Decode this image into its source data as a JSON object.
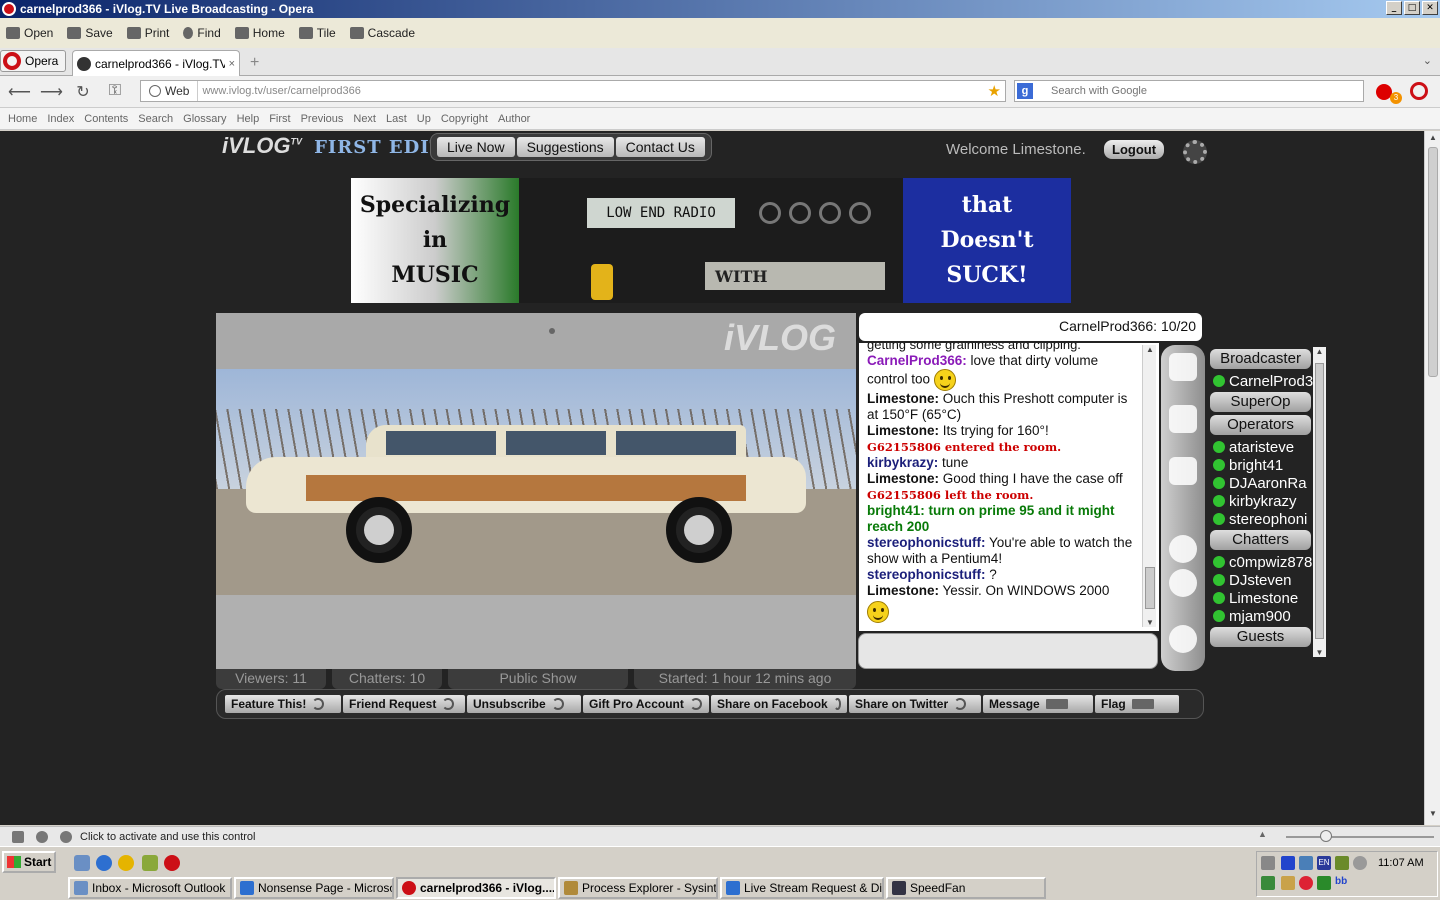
{
  "window": {
    "title": "carnelprod366 - iVlog.TV Live Broadcasting - Opera",
    "min": "_",
    "max": "□",
    "close": "✕"
  },
  "toolbar": {
    "items": [
      "Open",
      "Save",
      "Print",
      "Find",
      "Home",
      "Tile",
      "Cascade"
    ]
  },
  "tabs": {
    "opera_label": "Opera",
    "active_tab": "carnelprod366 - iVlog.TV ...",
    "close": "×",
    "new": "+",
    "menu": "⌄"
  },
  "address": {
    "site_label": "Web",
    "url_host": "www.ivlog.tv",
    "url_path": "/user/carnelprod366",
    "search_engine": "g",
    "search_placeholder": "Search with Google",
    "badge": "3"
  },
  "linkbar": {
    "items": [
      "Home",
      "Index",
      "Contents",
      "Search",
      "Glossary",
      "Help",
      "First",
      "Previous",
      "Next",
      "Last",
      "Up",
      "Copyright",
      "Author"
    ]
  },
  "site": {
    "logo": "iVLOG",
    "logo_tv": "TV",
    "edition": "FIRST EDITION",
    "nav": [
      "Live Now",
      "Suggestions",
      "Contact Us"
    ],
    "welcome": "Welcome Limestone.",
    "logout": "Logout"
  },
  "banner": {
    "left": [
      "Specializing",
      "in",
      "MUSIC"
    ],
    "lcd": "LOW END RADIO",
    "with": "WITH",
    "right": [
      "that",
      "Doesn't",
      "SUCK!"
    ]
  },
  "video": {
    "watermark": "iVLOG",
    "stats": {
      "viewers": "Viewers: 11",
      "chatters": "Chatters: 10",
      "show_type": "Public Show",
      "started": "Started: 1 hour 12 mins ago"
    }
  },
  "actions": [
    "Feature This!",
    "Friend Request",
    "Unsubscribe",
    "Gift Pro Account",
    "Share on Facebook",
    "Share on Twitter",
    "Message",
    "Flag"
  ],
  "chat": {
    "header": "CarnelProd366: 10/20",
    "partial_top": "getting some graininess and clipping.",
    "messages": [
      {
        "user": "CarnelProd366:",
        "text": " love that dirty volume control too",
        "cls": "u-purple",
        "smiley": true
      },
      {
        "user": "Limestone:",
        "text": " Ouch this Preshott computer is at 150°F (65°C)",
        "cls": "u-black"
      },
      {
        "user": "Limestone:",
        "text": " Its trying for 160°!",
        "cls": "u-black"
      },
      {
        "system": "G62155806 entered the room."
      },
      {
        "user": "kirbykrazy:",
        "text": " tune",
        "cls": "u-navy"
      },
      {
        "user": "Limestone:",
        "text": " Good thing I have the case off",
        "cls": "u-black"
      },
      {
        "system": "G62155806 left the room."
      },
      {
        "user": "bright41:",
        "text": " turn on prime 95 and it might reach 200",
        "cls": "u-green",
        "green": true
      },
      {
        "user": "stereophonicstuff:",
        "text": " You're able to watch the show with a Pentium4!",
        "cls": "u-navy"
      },
      {
        "user": "stereophonicstuff:",
        "text": " ?",
        "cls": "u-navy"
      },
      {
        "user": "Limestone:",
        "text": " Yessir. On WINDOWS 2000",
        "cls": "u-black",
        "smiley_block": true
      }
    ]
  },
  "users": {
    "groups": [
      {
        "label": "Broadcaster",
        "members": [
          "CarnelProd3"
        ]
      },
      {
        "label": "SuperOp",
        "members": []
      },
      {
        "label": "Operators",
        "members": [
          "ataristeve",
          "bright41",
          "DJAaronRa",
          "kirbykrazy",
          "stereophoni"
        ]
      },
      {
        "label": "Chatters",
        "members": [
          "c0mpwiz878",
          "DJsteven",
          "Limestone",
          "mjam900"
        ]
      },
      {
        "label": "Guests",
        "members": []
      }
    ]
  },
  "status": {
    "text": "Click to activate and use this control"
  },
  "taskbar": {
    "start": "Start",
    "tasks": [
      "Inbox - Microsoft Outlook",
      "Nonsense Page - Microsof...",
      "carnelprod366 - iVlog....",
      "Process Explorer - Sysint...",
      "Live Stream Request & Di...",
      "SpeedFan"
    ],
    "clock": "11:07 AM",
    "lang": "EN",
    "bb": "bb"
  }
}
